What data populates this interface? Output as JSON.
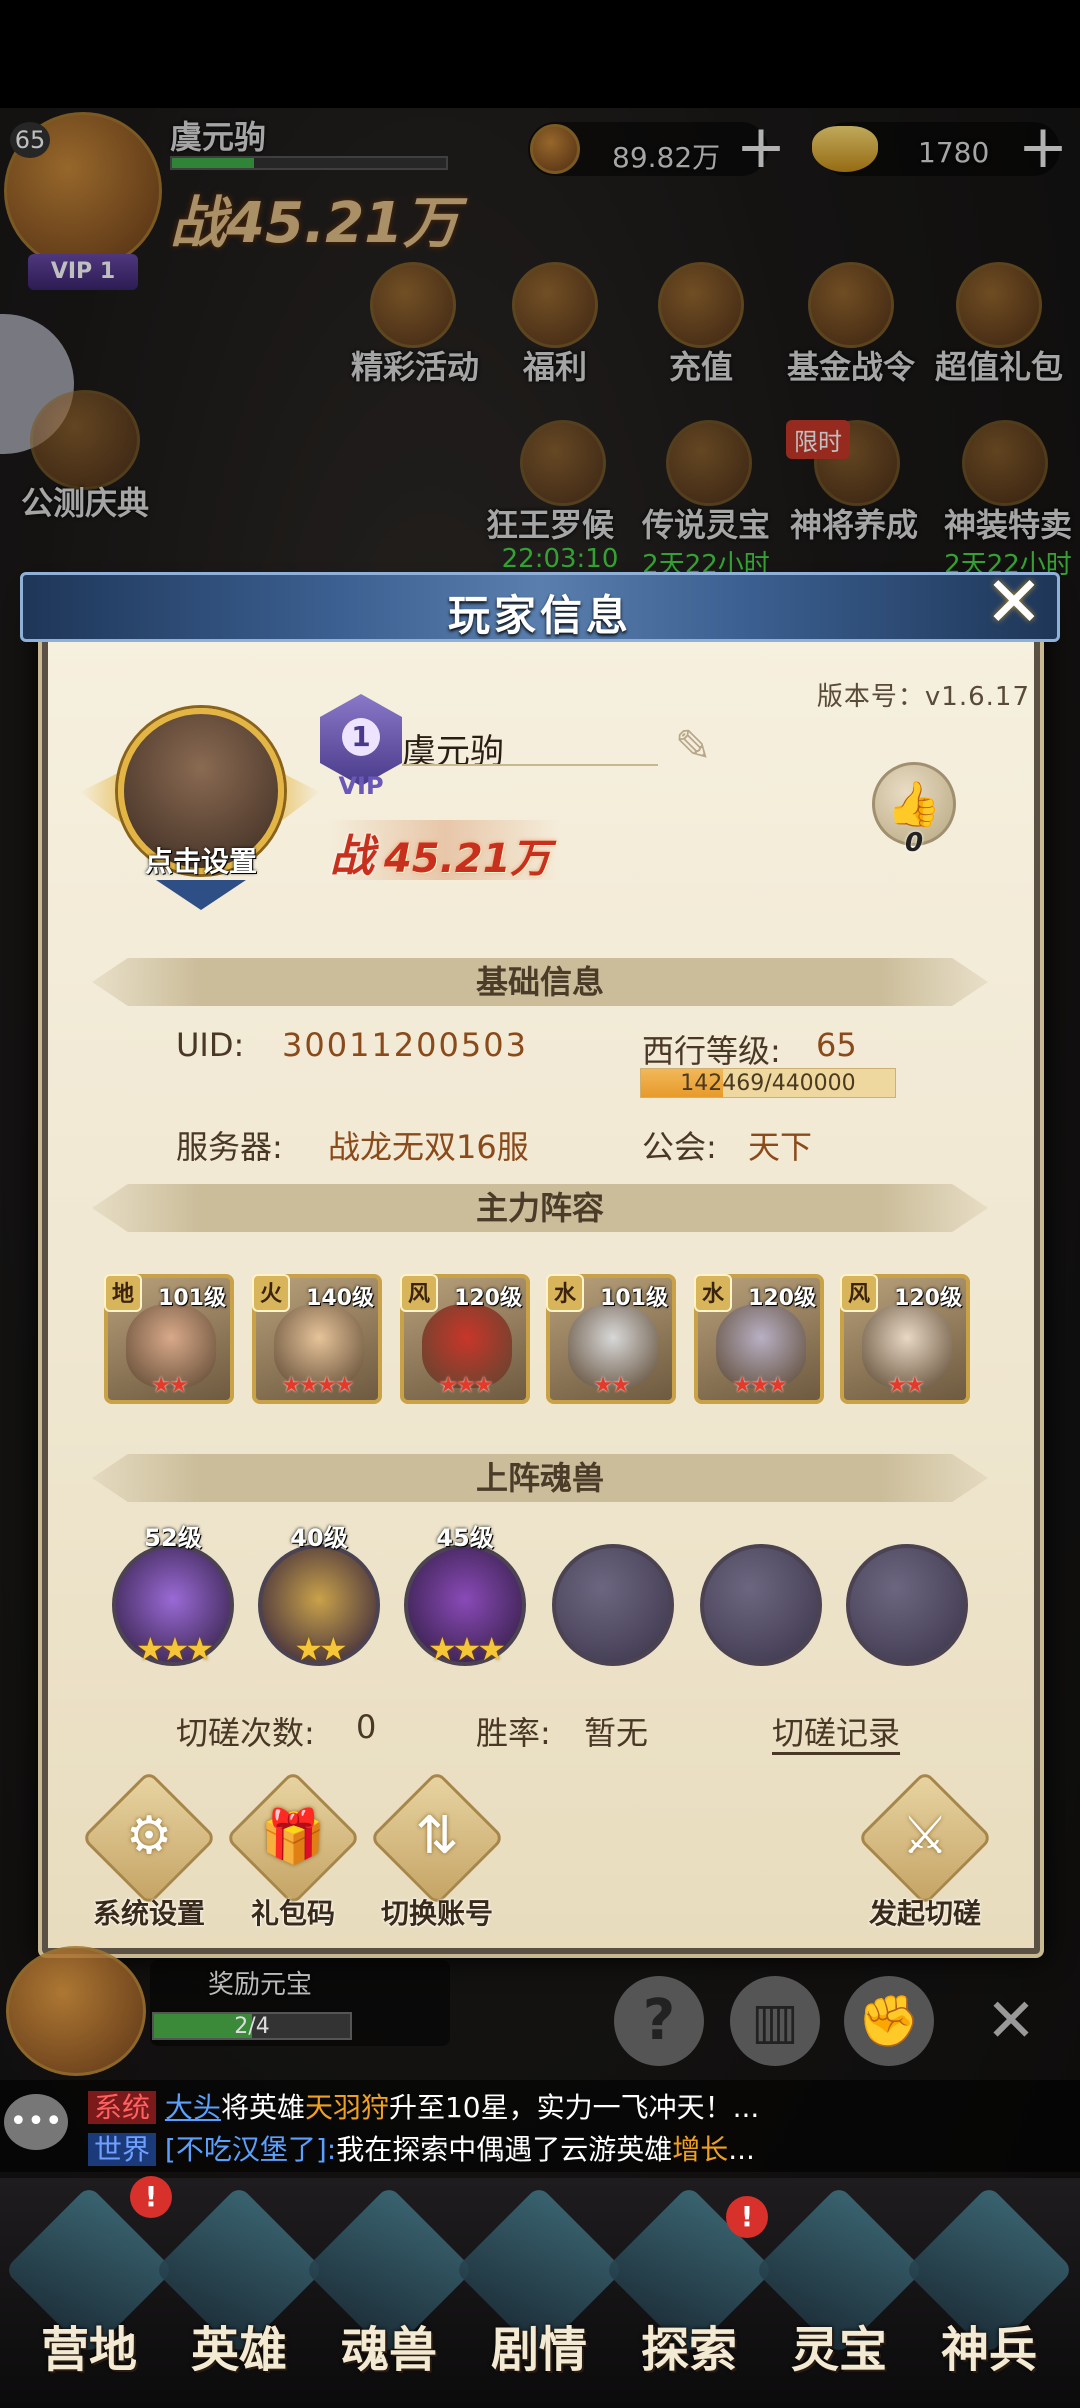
{
  "player": {
    "name": "虞元驹",
    "level_badge": "65",
    "vip_label": "VIP 1",
    "power_banner": "战45.21万",
    "copper": "89.82万",
    "gold": "1780"
  },
  "top_events": [
    {
      "label": "精彩活动"
    },
    {
      "label": "福利"
    },
    {
      "label": "充值"
    },
    {
      "label": "基金战令"
    },
    {
      "label": "超值礼包"
    }
  ],
  "second_events": [
    {
      "label": "狂王罗候",
      "timer": "22:03:10"
    },
    {
      "label": "传说灵宝",
      "timer": "2天22小时"
    },
    {
      "label": "神将养成",
      "badge": "限时"
    },
    {
      "label": "神装特卖",
      "timer": "2天22小时"
    }
  ],
  "left_event": {
    "label": "公测庆典"
  },
  "modal": {
    "title": "玩家信息",
    "version": "版本号：v1.6.17",
    "name": "虞元驹",
    "vip_number": "1",
    "vip_text": "VIP",
    "avatar_caption": "点击设置",
    "power_prefix": "战",
    "power_value": "45.21万",
    "likes": "0",
    "basic_header": "基础信息",
    "uid_label": "UID:",
    "uid_value": "30011200503",
    "level_label": "西行等级:",
    "level_value": "65",
    "exp_text": "142469/440000",
    "exp_fraction": 0.324,
    "server_label": "服务器:",
    "server_value": "战龙无双16服",
    "guild_label": "公会:",
    "guild_value": "天下",
    "lineup_header": "主力阵容",
    "heroes": [
      {
        "element": "地",
        "level": "101级",
        "stars": "★★",
        "color": "#d9a98a"
      },
      {
        "element": "火",
        "level": "140级",
        "stars": "★★★★",
        "color": "#e6c39a"
      },
      {
        "element": "风",
        "level": "120级",
        "stars": "★★★",
        "color": "#c8362a"
      },
      {
        "element": "水",
        "level": "101级",
        "stars": "★★",
        "color": "#d8d8d8"
      },
      {
        "element": "水",
        "level": "120级",
        "stars": "★★★",
        "color": "#b8b0c4"
      },
      {
        "element": "风",
        "level": "120级",
        "stars": "★★",
        "color": "#e8d8c4"
      }
    ],
    "beast_header": "上阵魂兽",
    "beasts": [
      {
        "level": "52级",
        "stars": "★★★",
        "filled": true,
        "color": "#9a6ad6"
      },
      {
        "level": "40级",
        "stars": "★★",
        "filled": true,
        "color": "#c9a24a"
      },
      {
        "level": "45级",
        "stars": "★★★",
        "filled": true,
        "color": "#8a4ab8"
      },
      {
        "level": "",
        "stars": "",
        "filled": false
      },
      {
        "level": "",
        "stars": "",
        "filled": false
      },
      {
        "level": "",
        "stars": "",
        "filled": false
      }
    ],
    "spar_count_label": "切磋次数:",
    "spar_count_value": "0",
    "winrate_label": "胜率:",
    "winrate_value": "暂无",
    "spar_record": "切磋记录",
    "buttons": {
      "settings": "系统设置",
      "gift_code": "礼包码",
      "switch_account": "切换账号",
      "start_spar": "发起切磋"
    }
  },
  "bottom_hud": {
    "reward_label": "奖励元宝",
    "reward_progress": "2/4",
    "reward_fraction": 0.5
  },
  "chat": {
    "line1_tag": "系统",
    "line1_name": "大头",
    "line1_text_a": "将英雄",
    "line1_hero": "天羽狩",
    "line1_text_b": "升至10星，实力一飞冲天！...",
    "line2_tag": "世界",
    "line2_name": "[不吃汉堡了]:",
    "line2_text_a": "我在探索中偶遇了云游英雄",
    "line2_hero": "增长",
    "line2_text_b": "..."
  },
  "nav": [
    {
      "label": "营地"
    },
    {
      "label": "英雄"
    },
    {
      "label": "魂兽"
    },
    {
      "label": "剧情"
    },
    {
      "label": "探索"
    },
    {
      "label": "灵宝"
    },
    {
      "label": "神兵"
    }
  ]
}
